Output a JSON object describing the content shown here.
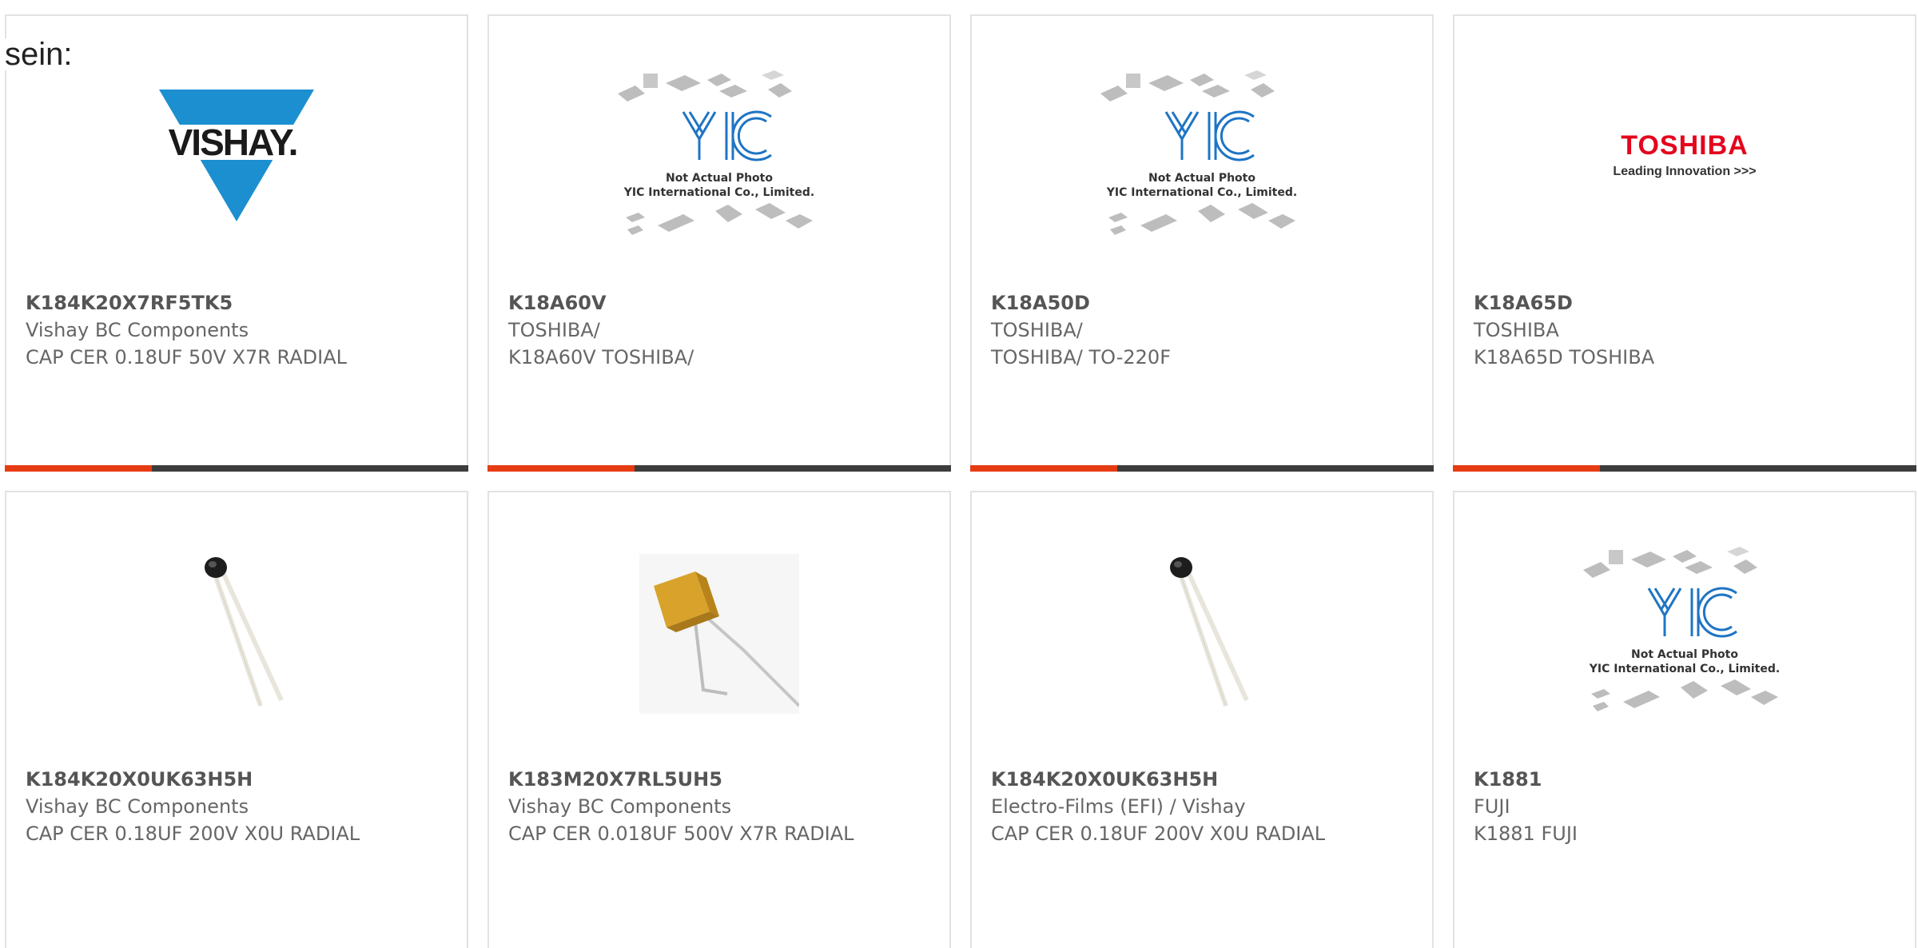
{
  "intro_text": "sein:",
  "accent_color": "#e63c12",
  "bar_color": "#3d3d3d",
  "products": [
    {
      "part_number": "K184K20X7RF5TK5",
      "manufacturer": "Vishay BC Components",
      "description": "CAP CER 0.18UF 50V X7R RADIAL",
      "image": "vishay-logo"
    },
    {
      "part_number": "K18A60V",
      "manufacturer": "TOSHIBA/",
      "description": "K18A60V TOSHIBA/",
      "image": "yic-placeholder",
      "placeholder_line1": "Not Actual Photo",
      "placeholder_line2": "YIC International Co., Limited."
    },
    {
      "part_number": "K18A50D",
      "manufacturer": "TOSHIBA/",
      "description": "TOSHIBA/ TO-220F",
      "image": "yic-placeholder",
      "placeholder_line1": "Not Actual Photo",
      "placeholder_line2": "YIC International Co., Limited."
    },
    {
      "part_number": "K18A65D",
      "manufacturer": "TOSHIBA",
      "description": "K18A65D TOSHIBA",
      "image": "toshiba-logo",
      "logo_text": "TOSHIBA",
      "logo_tagline": "Leading Innovation >>>"
    },
    {
      "part_number": "K184K20X0UK63H5H",
      "manufacturer": "Vishay BC Components",
      "description": "CAP CER 0.18UF 200V X0U RADIAL",
      "image": "disc-capacitor-photo"
    },
    {
      "part_number": "K183M20X7RL5UH5",
      "manufacturer": "Vishay BC Components",
      "description": "CAP CER 0.018UF 500V X7R RADIAL",
      "image": "yellow-capacitor-photo"
    },
    {
      "part_number": "K184K20X0UK63H5H",
      "manufacturer": "Electro-Films (EFI) / Vishay",
      "description": "CAP CER 0.18UF 200V X0U RADIAL",
      "image": "disc-capacitor-photo"
    },
    {
      "part_number": "K1881",
      "manufacturer": "FUJI",
      "description": "K1881 FUJI",
      "image": "yic-placeholder",
      "placeholder_line1": "Not Actual Photo",
      "placeholder_line2": "YIC International Co., Limited."
    }
  ],
  "vishay_logo_text": "VISHAY."
}
